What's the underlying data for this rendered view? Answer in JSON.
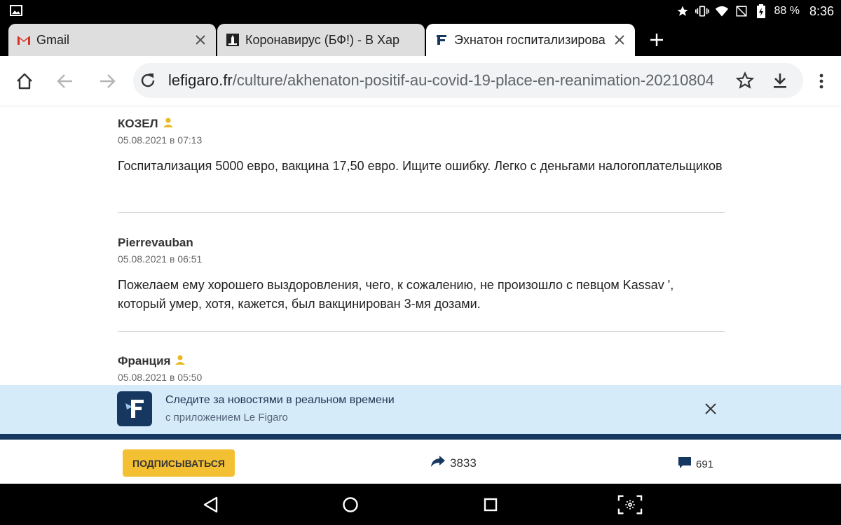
{
  "status_bar": {
    "battery": "88 %",
    "time": "8:36"
  },
  "tabs": [
    {
      "title": "Gmail",
      "favicon": "gmail-icon"
    },
    {
      "title": "Коронавирус (БФ!) - В Хар",
      "favicon": "monument-icon"
    },
    {
      "title": "Эхнатон госпитализирова",
      "favicon": "figaro-f-icon"
    }
  ],
  "toolbar": {
    "url_host": "lefigaro.fr",
    "url_path": "/culture/akhenaton-positif-au-covid-19-place-en-reanimation-20210804"
  },
  "comments": [
    {
      "author": "КОЗЕЛ",
      "verified": true,
      "date": "05.08.2021 в 07:13",
      "text": "Госпитализация 5000 евро, вакцина 17,50 евро. Ищите ошибку. Легко с деньгами налогоплательщиков"
    },
    {
      "author": "Pierrevauban",
      "verified": false,
      "date": "05.08.2021 в 06:51",
      "text": "Пожелаем ему хорошего выздоровления, чего, к сожалению, не произошло с певцом Kassav ', который умер, хотя, кажется, был вакцинирован 3-мя дозами."
    },
    {
      "author": "Франция",
      "verified": true,
      "date": "05.08.2021 в 05:50",
      "text": ""
    }
  ],
  "app_banner": {
    "title": "Следите за новостями в реальном времени",
    "subtitle": "с приложением Le Figaro"
  },
  "action_bar": {
    "subscribe_label": "ПОДПИСЫВАТЬСЯ",
    "share_count": "3833",
    "comment_count": "691"
  },
  "colors": {
    "accent_yellow": "#f4c033",
    "figaro_navy": "#163860",
    "banner_bg": "#d6ebfa"
  }
}
